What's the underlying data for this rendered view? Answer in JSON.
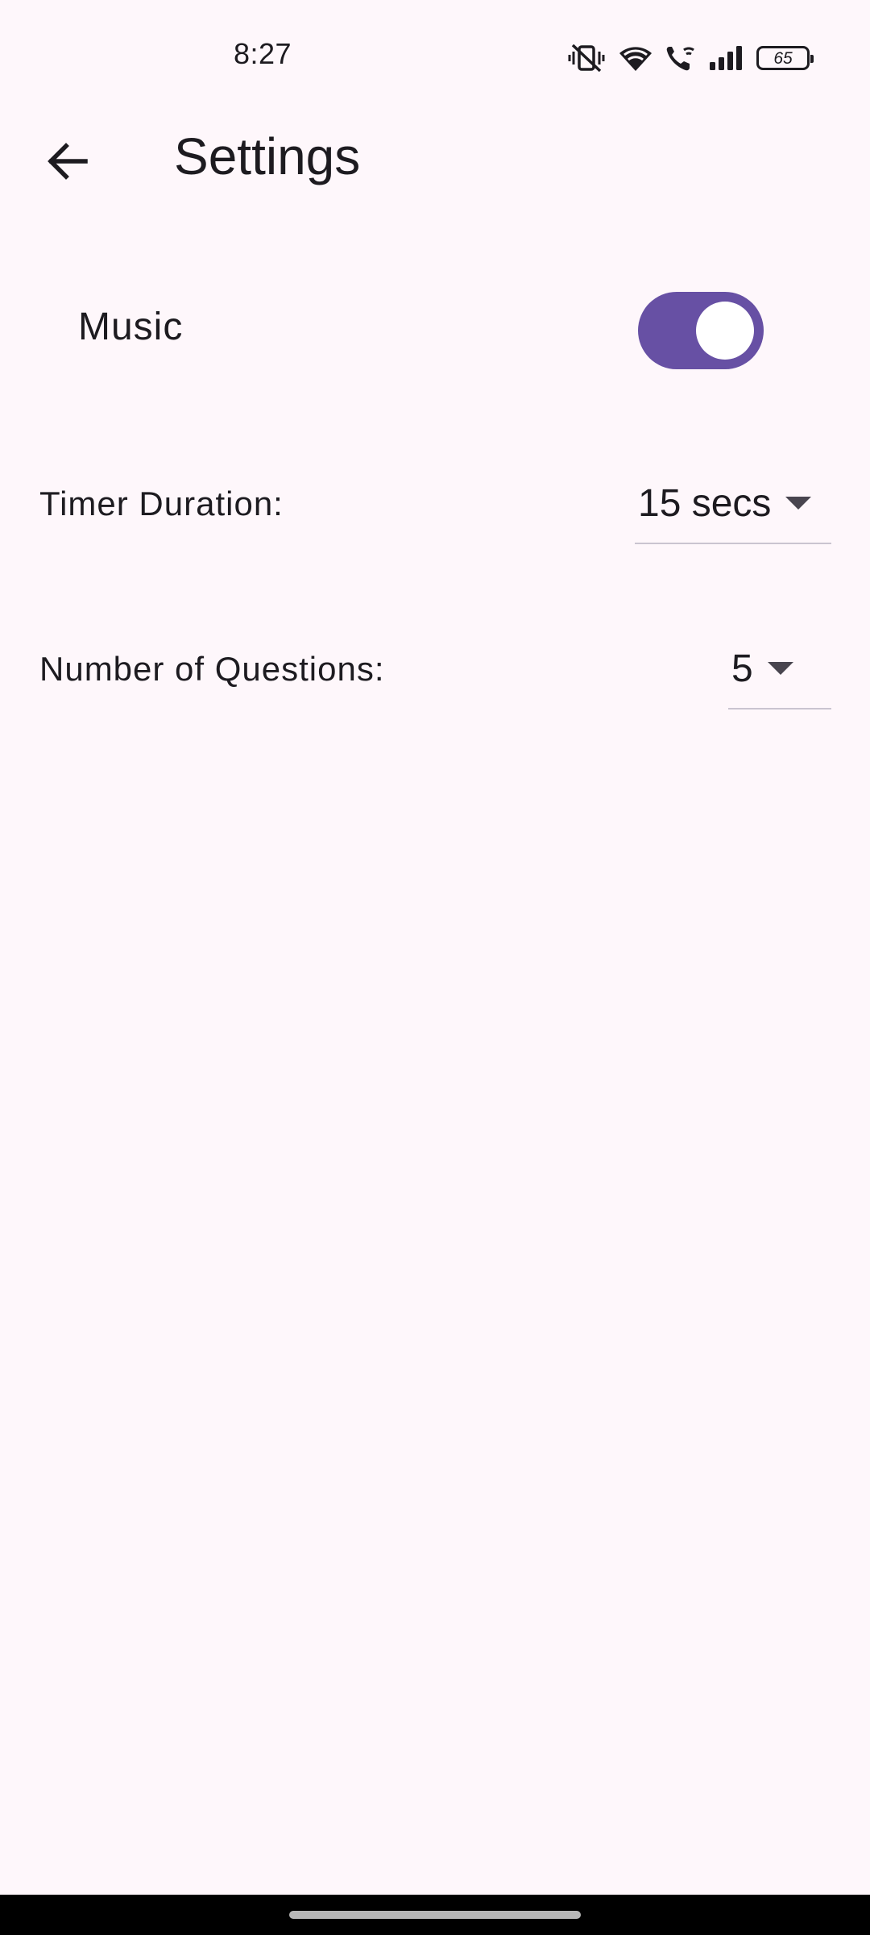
{
  "status_bar": {
    "time": "8:27",
    "battery_level": "65",
    "icons": [
      "vibrate-icon",
      "wifi-icon",
      "wifi-call-icon",
      "signal-icon",
      "battery-icon"
    ]
  },
  "app_bar": {
    "back_icon": "arrow-back-icon",
    "title": "Settings"
  },
  "settings": {
    "music": {
      "label": "Music",
      "enabled": true
    },
    "timer_duration": {
      "label": "Timer Duration:",
      "value": "15 secs"
    },
    "number_of_questions": {
      "label": "Number of Questions:",
      "value": "5"
    }
  },
  "colors": {
    "background": "#fef7fb",
    "accent": "#6750a4",
    "text": "#1d1b20",
    "divider": "#cac4d0"
  }
}
